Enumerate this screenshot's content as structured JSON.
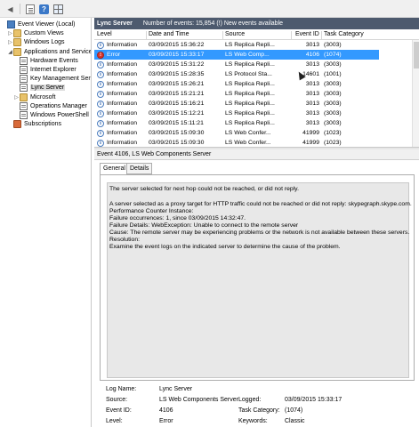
{
  "toolbar": {
    "icons": [
      "document-icon",
      "help-icon",
      "grid-icon"
    ]
  },
  "tree": {
    "items": [
      {
        "label": "Event Viewer (Local)",
        "icon": "event-viewer-icon",
        "expander": "",
        "level": 0
      },
      {
        "label": "Custom Views",
        "icon": "folder-icon",
        "expander": "▷",
        "level": 1
      },
      {
        "label": "Windows Logs",
        "icon": "folder-icon",
        "expander": "▷",
        "level": 1
      },
      {
        "label": "Applications and Services Lo",
        "icon": "folder-icon",
        "expander": "◢",
        "level": 1
      },
      {
        "label": "Hardware Events",
        "icon": "log-icon",
        "expander": "",
        "level": 2
      },
      {
        "label": "Internet Explorer",
        "icon": "log-icon",
        "expander": "",
        "level": 2
      },
      {
        "label": "Key Management Service",
        "icon": "log-icon",
        "expander": "",
        "level": 2
      },
      {
        "label": "Lync Server",
        "icon": "log-icon",
        "expander": "",
        "level": 2,
        "selected": true
      },
      {
        "label": "Microsoft",
        "icon": "folder-icon",
        "expander": "▷",
        "level": 2
      },
      {
        "label": "Operations Manager",
        "icon": "log-icon",
        "expander": "",
        "level": 2
      },
      {
        "label": "Windows PowerShell",
        "icon": "log-icon",
        "expander": "",
        "level": 2
      },
      {
        "label": "Subscriptions",
        "icon": "subscriptions-icon",
        "expander": "",
        "level": 1
      }
    ]
  },
  "list": {
    "title": "Lync Server",
    "summary": "Number of events: 15,854 (!) New events available",
    "columns": [
      "Level",
      "Date and Time",
      "Source",
      "Event ID",
      "Task Category"
    ],
    "rows": [
      {
        "level": "Information",
        "datetime": "03/09/2015 15:36:22",
        "source": "LS Replica Repli...",
        "event_id": "3013",
        "category": "(3003)"
      },
      {
        "level": "Error",
        "datetime": "03/09/2015 15:33:17",
        "source": "LS Web Comp...",
        "event_id": "4106",
        "category": "(1074)",
        "selected": true
      },
      {
        "level": "Information",
        "datetime": "03/09/2015 15:31:22",
        "source": "LS Replica Repli...",
        "event_id": "3013",
        "category": "(3003)"
      },
      {
        "level": "Information",
        "datetime": "03/09/2015 15:28:35",
        "source": "LS Protocol Sta...",
        "event_id": "14601",
        "category": "(1001)"
      },
      {
        "level": "Information",
        "datetime": "03/09/2015 15:26:21",
        "source": "LS Replica Repli...",
        "event_id": "3013",
        "category": "(3003)"
      },
      {
        "level": "Information",
        "datetime": "03/09/2015 15:21:21",
        "source": "LS Replica Repli...",
        "event_id": "3013",
        "category": "(3003)"
      },
      {
        "level": "Information",
        "datetime": "03/09/2015 15:16:21",
        "source": "LS Replica Repli...",
        "event_id": "3013",
        "category": "(3003)"
      },
      {
        "level": "Information",
        "datetime": "03/09/2015 15:12:21",
        "source": "LS Replica Repli...",
        "event_id": "3013",
        "category": "(3003)"
      },
      {
        "level": "Information",
        "datetime": "03/09/2015 15:11:21",
        "source": "LS Replica Repli...",
        "event_id": "3013",
        "category": "(3003)"
      },
      {
        "level": "Information",
        "datetime": "03/09/2015 15:09:30",
        "source": "LS Web Confer...",
        "event_id": "41999",
        "category": "(1023)"
      },
      {
        "level": "Information",
        "datetime": "03/09/2015 15:09:30",
        "source": "LS Web Confer...",
        "event_id": "41999",
        "category": "(1023)"
      }
    ]
  },
  "detail": {
    "title": "Event 4106, LS Web Components Server",
    "tabs": [
      "General",
      "Details"
    ],
    "description": [
      "The server selected for next hop could not be reached, or did not reply.",
      "",
      "A server selected as a proxy target for HTTP traffic could not be reached or did not reply: skypegraph.skype.com.",
      "Performance Counter Instance:",
      "Failure occurrences: 1, since 03/09/2015 14:32:47.",
      "Failure Details: WebException: Unable to connect to the remote server",
      "Cause: The remote server may be experiencing problems or the network is not available between these servers.",
      "Resolution:",
      "Examine the event logs on the indicated server to determine the cause of the problem."
    ],
    "props": {
      "log_name_label": "Log Name:",
      "log_name": "Lync Server",
      "source_label": "Source:",
      "source": "LS Web Components Server",
      "logged_label": "Logged:",
      "logged": "03/09/2015 15:33:17",
      "event_id_label": "Event ID:",
      "event_id": "4106",
      "task_cat_label": "Task Category:",
      "task_cat": "(1074)",
      "level_label": "Level:",
      "level": "Error",
      "keywords_label": "Keywords:",
      "keywords": "Classic"
    }
  }
}
